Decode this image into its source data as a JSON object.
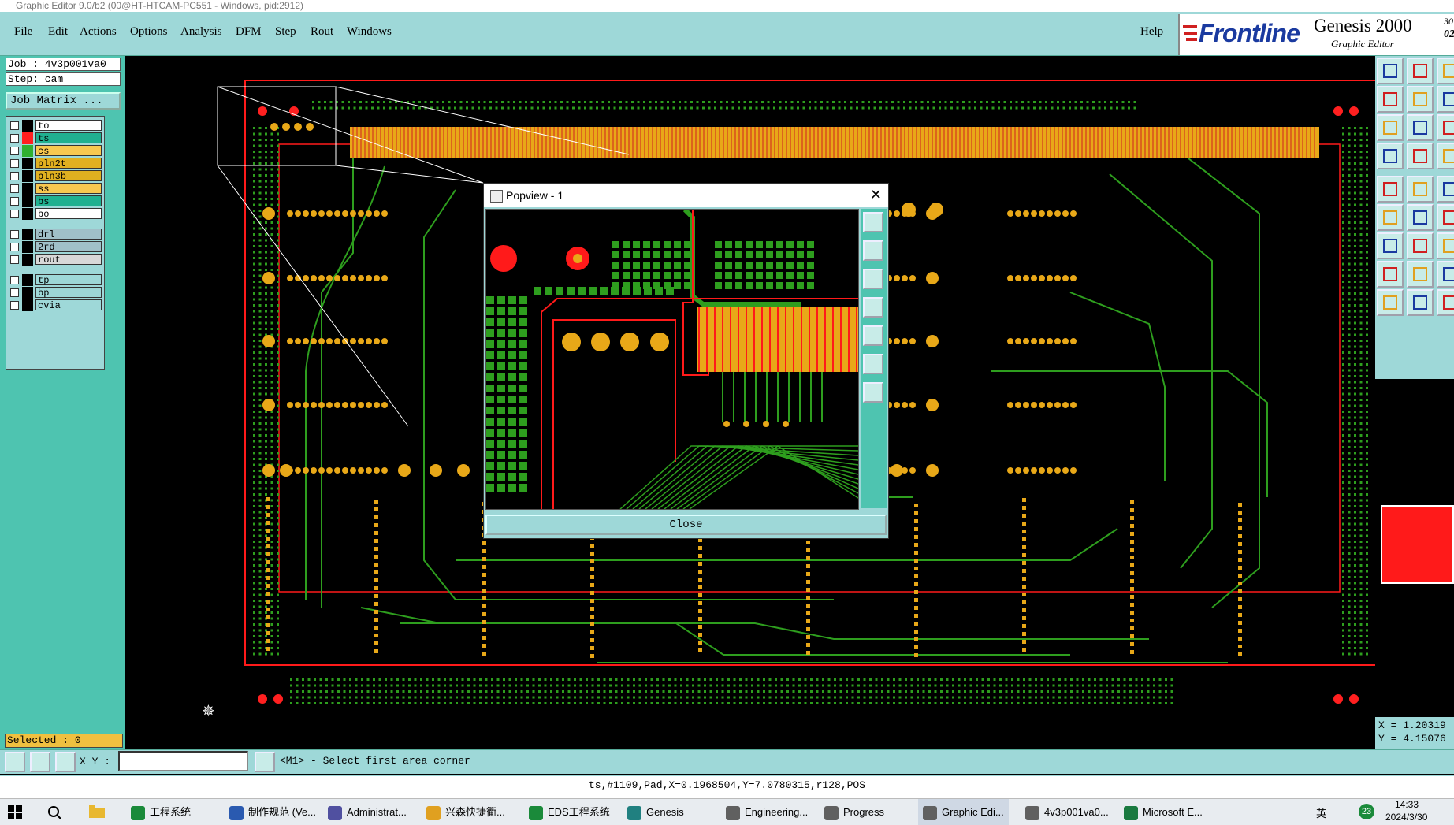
{
  "window": {
    "title": "Graphic Editor 9.0/b2 (00@HT-HTCAM-PC551 - Windows, pid:2912)"
  },
  "menu": {
    "file": "File",
    "edit": "Edit",
    "actions": "Actions",
    "options": "Options",
    "analysis": "Analysis",
    "dfm": "DFM",
    "step": "Step",
    "rout": "Rout",
    "windows": "Windows",
    "help": "Help"
  },
  "brand": {
    "logo": "Frontline",
    "product": "Genesis 2000",
    "subtitle": "Graphic Editor",
    "time_top": "30",
    "time_bottom": "02:"
  },
  "job": {
    "job_line": "Job : 4v3p001va0",
    "step_line": "Step: cam",
    "matrix_button": "Job Matrix ..."
  },
  "layers": [
    {
      "name": "to",
      "color": "#ffffff",
      "swatch": "#000000"
    },
    {
      "name": "ts",
      "color": "#20b090",
      "swatch": "#ff2020"
    },
    {
      "name": "cs",
      "color": "#f8c850",
      "swatch": "#30b030"
    },
    {
      "name": "pln2t",
      "color": "#e0b020",
      "swatch": "#000000"
    },
    {
      "name": "pln3b",
      "color": "#e0b020",
      "swatch": "#000000"
    },
    {
      "name": "ss",
      "color": "#f8c850",
      "swatch": "#000000"
    },
    {
      "name": "bs",
      "color": "#20b090",
      "swatch": "#000000"
    },
    {
      "name": "bo",
      "color": "#ffffff",
      "swatch": "#000000"
    },
    {
      "name": "drl",
      "color": "#a0c0c8",
      "swatch": "#000000"
    },
    {
      "name": "2rd",
      "color": "#a0c0c8",
      "swatch": "#000000"
    },
    {
      "name": "rout",
      "color": "#d8d8d8",
      "swatch": "#000000"
    },
    {
      "name": "tp",
      "color": "#9ed8d8",
      "swatch": "#000000"
    },
    {
      "name": "bp",
      "color": "#9ed8d8",
      "swatch": "#000000"
    },
    {
      "name": "cvia",
      "color": "#9ed8d8",
      "swatch": "#000000"
    }
  ],
  "selected": "Selected : 0",
  "popview": {
    "title": "Popview - 1",
    "close_label": "Close"
  },
  "coords": {
    "x": "X = 1.20319",
    "y": "Y = 4.15076"
  },
  "input": {
    "xy_label": "X Y :",
    "prompt": "<M1> - Select first area corner"
  },
  "status": "ts,#1109,Pad,X=0.1968504,Y=7.0780315,r128,POS",
  "taskbar": {
    "items": [
      {
        "label": "工程系统",
        "color": "#1a8a3a"
      },
      {
        "label": "制作规范 (Ve...",
        "color": "#2a5ab0"
      },
      {
        "label": "Administrat...",
        "color": "#5050a0"
      },
      {
        "label": "兴森快捷衢...",
        "color": "#e0a020"
      },
      {
        "label": "EDS工程系统",
        "color": "#1a8a3a"
      },
      {
        "label": "Genesis",
        "color": "#208080"
      },
      {
        "label": "Engineering...",
        "color": "#606060"
      },
      {
        "label": "Progress",
        "color": "#606060"
      },
      {
        "label": "Graphic Edi...",
        "color": "#606060"
      },
      {
        "label": "4v3p001va0...",
        "color": "#606060"
      },
      {
        "label": "Microsoft E...",
        "color": "#1a7a40"
      }
    ],
    "lang": "英",
    "time": "14:33",
    "date": "2024/3/30",
    "badge": "23"
  },
  "colors": {
    "trace": "#2e9e1e",
    "pad": "#e8a818",
    "outline": "#ff1a1a",
    "panel": "#9ed8d8",
    "panel_dark": "#4ec4b0"
  }
}
